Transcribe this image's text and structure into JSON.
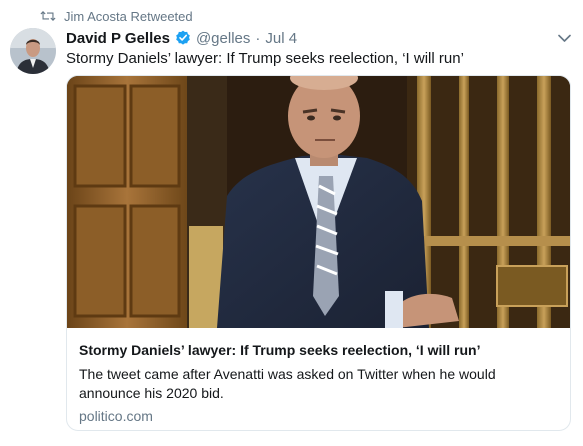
{
  "retweet": {
    "icon": "retweet-icon",
    "label": "Jim Acosta Retweeted"
  },
  "tweet": {
    "author_name": "David P Gelles",
    "verified_icon": "verified-badge-icon",
    "handle": "@gelles",
    "separator": "·",
    "date": "Jul 4",
    "text": "Stormy Daniels’ lawyer: If Trump seeks reelection, ‘I will run’",
    "menu_icon": "chevron-down-icon"
  },
  "card": {
    "title": "Stormy Daniels’ lawyer: If Trump seeks reelection, ‘I will run’",
    "description": "The tweet came after Avenatti was asked on Twitter when he would announce his 2020 bid.",
    "domain": "politico.com"
  },
  "colors": {
    "accent": "#1da1f2",
    "secondary_text": "#657786",
    "border": "#e1e8ed"
  }
}
